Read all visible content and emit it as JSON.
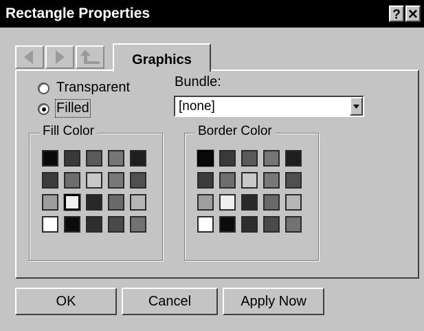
{
  "window": {
    "title": "Rectangle Properties",
    "help_label": "?",
    "close_label": "✕"
  },
  "tabs": [
    {
      "label": "Graphics"
    }
  ],
  "nav": {
    "back_icon": "left-arrow-icon",
    "forward_icon": "right-arrow-icon",
    "up_icon": "up-level-icon"
  },
  "fill_mode": {
    "transparent_label": "Transparent",
    "filled_label": "Filled",
    "selected": "Filled"
  },
  "bundle": {
    "label": "Bundle:",
    "value": "[none]"
  },
  "fill_color": {
    "label": "Fill Color",
    "selected_index": 11,
    "swatches": [
      "#0a0a0a",
      "#3a3a3a",
      "#5a5a5a",
      "#767676",
      "#1e1e1e",
      "#3c3c3c",
      "#6e6e6e",
      "#c8c8c8",
      "#787878",
      "#505050",
      "#9e9e9e",
      "#eeeeee",
      "#282828",
      "#6a6a6a",
      "#b6b6b6",
      "#ffffff",
      "#0c0c0c",
      "#2e2e2e",
      "#4a4a4a",
      "#727272"
    ]
  },
  "border_color": {
    "label": "Border Color",
    "selected_index": 0,
    "swatches": [
      "#0a0a0a",
      "#3a3a3a",
      "#5a5a5a",
      "#767676",
      "#1e1e1e",
      "#3c3c3c",
      "#6e6e6e",
      "#c8c8c8",
      "#787878",
      "#505050",
      "#9e9e9e",
      "#eeeeee",
      "#282828",
      "#6a6a6a",
      "#b6b6b6",
      "#ffffff",
      "#0c0c0c",
      "#2e2e2e",
      "#4a4a4a",
      "#727272"
    ]
  },
  "buttons": {
    "ok": "OK",
    "cancel": "Cancel",
    "apply": "Apply Now"
  }
}
